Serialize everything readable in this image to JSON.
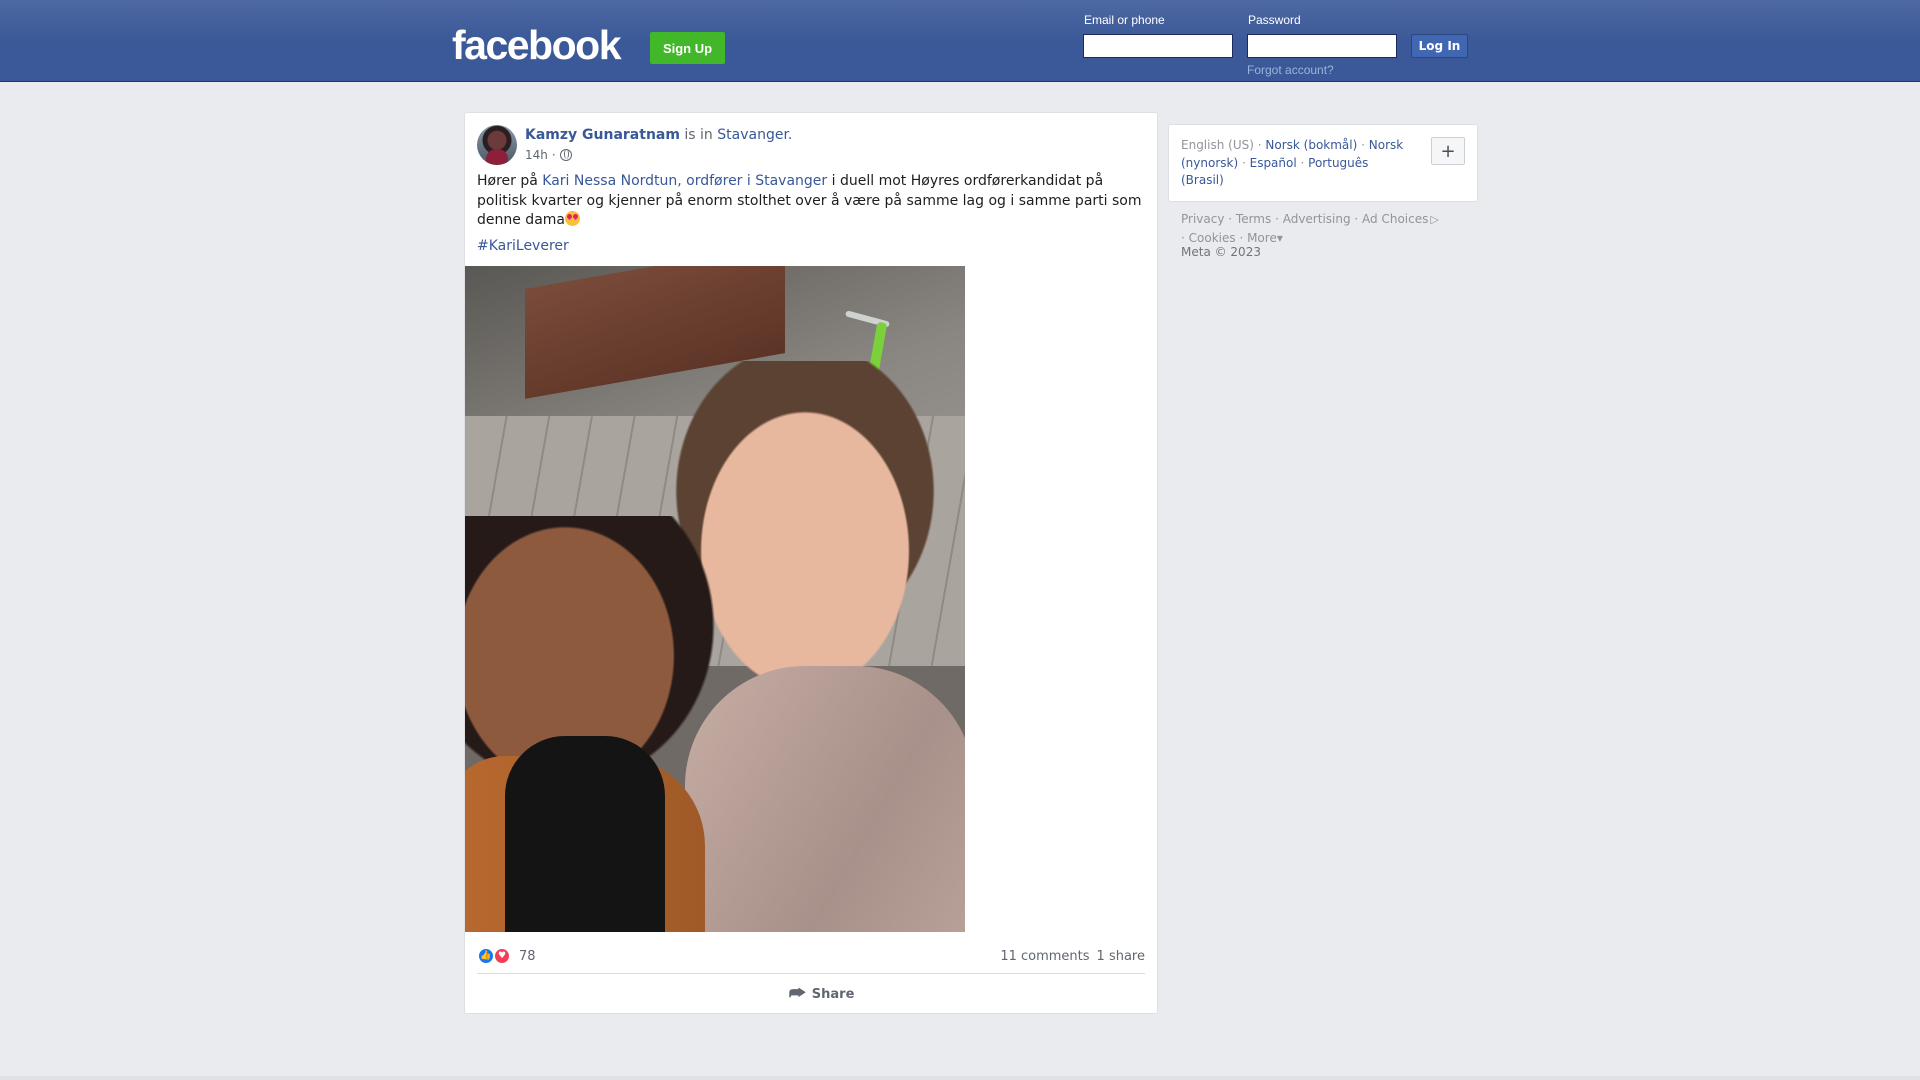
{
  "header": {
    "logo": "facebook",
    "signup_label": "Sign Up",
    "email_label": "Email or phone",
    "password_label": "Password",
    "login_label": "Log In",
    "forgot_label": "Forgot account?",
    "brand_color": "#3b5998",
    "signup_color": "#42b72a"
  },
  "post": {
    "author": "Kamzy Gunaratnam",
    "location_prefix": "is in",
    "location": "Stavanger.",
    "time": "14h",
    "privacy_icon": "globe-icon",
    "text_before": "Hører på",
    "mention": "Kari Nessa Nordtun, ordfører i Stavanger",
    "text_after": "i duell mot Høyres ordførerkandidat på politisk kvarter og kjenner på enorm stolthet over å være på samme lag og i samme parti som denne dama",
    "emoji": "star-struck-emoji-icon",
    "hashtag": "#KariLeverer",
    "reaction_count": "78",
    "comments": "11 comments",
    "shares": "1 share",
    "share_label": "Share"
  },
  "sidebar": {
    "current_language": "English (US)",
    "languages": [
      "Norsk (bokmål)",
      "Norsk (nynorsk)",
      "Español",
      "Português (Brasil)"
    ],
    "add_language": "+",
    "footer_links": [
      "Privacy",
      "Terms",
      "Advertising",
      "Ad Choices",
      "Cookies",
      "More"
    ],
    "copyright": "Meta © 2023"
  }
}
